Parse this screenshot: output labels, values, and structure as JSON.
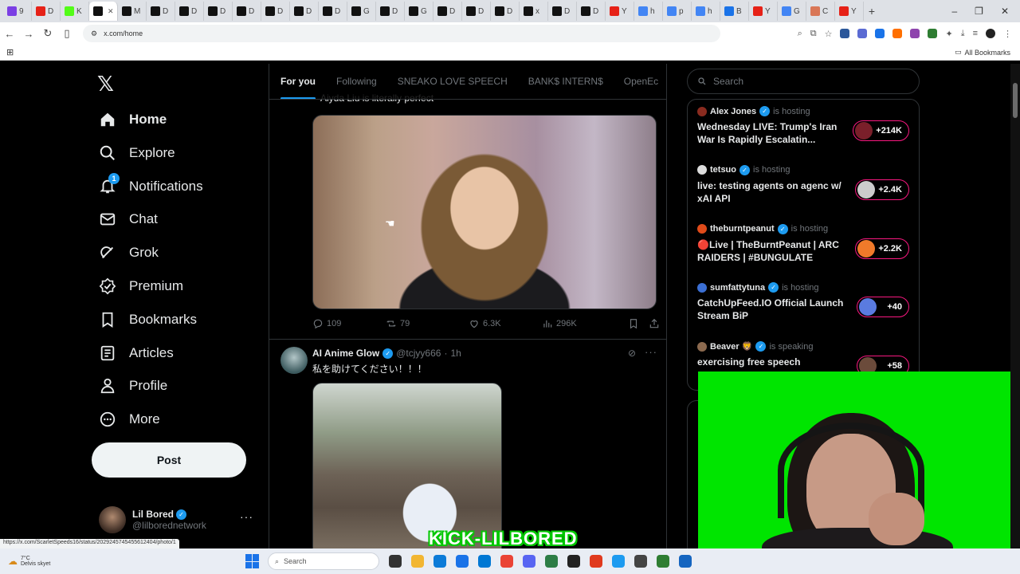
{
  "browser": {
    "tabs": [
      {
        "icon": "play-icon",
        "color": "#7b3fe4",
        "label": "9"
      },
      {
        "icon": "youtube-icon",
        "color": "#e62117",
        "label": "D"
      },
      {
        "icon": "kick-icon",
        "color": "#53fc18",
        "label": "K"
      },
      {
        "icon": "x-icon",
        "color": "#111111",
        "label": "",
        "active": true
      },
      {
        "icon": "x-icon",
        "color": "#111111",
        "label": "M"
      },
      {
        "icon": "x-icon",
        "color": "#111111",
        "label": "D"
      },
      {
        "icon": "x-icon",
        "color": "#111111",
        "label": "D"
      },
      {
        "icon": "x-icon",
        "color": "#111111",
        "label": "D"
      },
      {
        "icon": "x-icon",
        "color": "#111111",
        "label": "D"
      },
      {
        "icon": "x-icon",
        "color": "#111111",
        "label": "D"
      },
      {
        "icon": "x-icon",
        "color": "#111111",
        "label": "D"
      },
      {
        "icon": "x-icon",
        "color": "#111111",
        "label": "D"
      },
      {
        "icon": "x-icon",
        "color": "#111111",
        "label": "G"
      },
      {
        "icon": "x-icon",
        "color": "#111111",
        "label": "D"
      },
      {
        "icon": "x-icon",
        "color": "#111111",
        "label": "G"
      },
      {
        "icon": "x-icon",
        "color": "#111111",
        "label": "D"
      },
      {
        "icon": "x-icon",
        "color": "#111111",
        "label": "D"
      },
      {
        "icon": "x-icon",
        "color": "#111111",
        "label": "D"
      },
      {
        "icon": "x-icon",
        "color": "#111111",
        "label": "x"
      },
      {
        "icon": "x-icon",
        "color": "#111111",
        "label": "D"
      },
      {
        "icon": "x-icon",
        "color": "#111111",
        "label": "D"
      },
      {
        "icon": "youtube-icon",
        "color": "#e62117",
        "label": "Y"
      },
      {
        "icon": "google-icon",
        "color": "#4285f4",
        "label": "h"
      },
      {
        "icon": "google-icon",
        "color": "#4285f4",
        "label": "p"
      },
      {
        "icon": "google-icon",
        "color": "#4285f4",
        "label": "h"
      },
      {
        "icon": "star-icon",
        "color": "#1a73e8",
        "label": "B"
      },
      {
        "icon": "youtube-icon",
        "color": "#e62117",
        "label": "Y"
      },
      {
        "icon": "sparkle-icon",
        "color": "#4285f4",
        "label": "G"
      },
      {
        "icon": "claude-icon",
        "color": "#d97757",
        "label": "C"
      },
      {
        "icon": "youtube-icon",
        "color": "#e62117",
        "label": "Y"
      }
    ],
    "new_tab": "+",
    "window_controls": [
      "–",
      "❐",
      "✕"
    ],
    "url": "x.com/home",
    "all_bookmarks": "All Bookmarks",
    "status_url": "https://x.com/ScarletSpeeds16/status/2029245745455612404/photo/1"
  },
  "nav": {
    "items": [
      {
        "label": "Home",
        "icon": "home-icon",
        "active": true
      },
      {
        "label": "Explore",
        "icon": "search-icon"
      },
      {
        "label": "Notifications",
        "icon": "bell-icon",
        "badge": "1"
      },
      {
        "label": "Chat",
        "icon": "mail-icon"
      },
      {
        "label": "Grok",
        "icon": "grok-icon"
      },
      {
        "label": "Premium",
        "icon": "premium-icon"
      },
      {
        "label": "Bookmarks",
        "icon": "bookmark-icon"
      },
      {
        "label": "Articles",
        "icon": "articles-icon"
      },
      {
        "label": "Profile",
        "icon": "person-icon"
      },
      {
        "label": "More",
        "icon": "more-icon"
      }
    ],
    "post_label": "Post",
    "account": {
      "name": "Lil Bored",
      "handle": "@lilborednetwork"
    }
  },
  "feed": {
    "tabs": [
      "For you",
      "Following",
      "SNEAKO LOVE SPEECH",
      "BANK$ INTERN$",
      "OpenEc"
    ],
    "prev_caption": "Aiyda Liu is literally perfect",
    "tweet1_actions": {
      "replies": "109",
      "reposts": "79",
      "likes": "6.3K",
      "views": "296K"
    },
    "tweet2": {
      "name": "AI Anime Glow",
      "handle": "@tcjyy666",
      "dot": "·",
      "time": "1h",
      "text": "私を助けてください！！！"
    }
  },
  "search": {
    "placeholder": "Search"
  },
  "spaces": [
    {
      "host": "Alex Jones",
      "status": "is hosting",
      "title": "Wednesday LIVE: Trump's Iran War Is Rapidly Escalatin...",
      "count": "+214K",
      "avatar_color": "#8a2b1f",
      "count_color": "#7a1f2a"
    },
    {
      "host": "tetsuo",
      "status": "is hosting",
      "title": "live: testing agents on agenc w/ xAI API",
      "count": "+2.4K",
      "avatar_color": "#dddddd",
      "count_color": "#cccccc"
    },
    {
      "host": "theburntpeanut",
      "status": "is hosting",
      "title": "🔴Live | TheBurntPeanut | ARC RAIDERS | #BUNGULATE",
      "count": "+2.2K",
      "avatar_color": "#e04b1a",
      "count_color": "#f07a2a"
    },
    {
      "host": "sumfattytuna",
      "status": "is hosting",
      "title": "CatchUpFeed.IO Official Launch Stream BiP",
      "count": "+40",
      "avatar_color": "#3b6fd4",
      "count_color": "#5a7be0"
    },
    {
      "host": "Beaver 🦁",
      "status": "is speaking",
      "title": "exercising free speech",
      "count": "+58",
      "avatar_color": "#8c6a4f",
      "count_color": "#6b4b3b"
    }
  ],
  "overlay": {
    "watermark": "KICK-LILBORED"
  },
  "taskbar": {
    "weather_temp": "7°C",
    "weather_text": "Delvis skyet",
    "search_placeholder": "Search",
    "apps": [
      "#333333",
      "#f2b632",
      "#0c7bd8",
      "#1a73e8",
      "#0078d4",
      "#ea4335",
      "#5865f2",
      "#2d7d46",
      "#222222",
      "#e03a1e",
      "#1d9bf0",
      "#444444",
      "#2e7d32",
      "#1565c0"
    ]
  }
}
